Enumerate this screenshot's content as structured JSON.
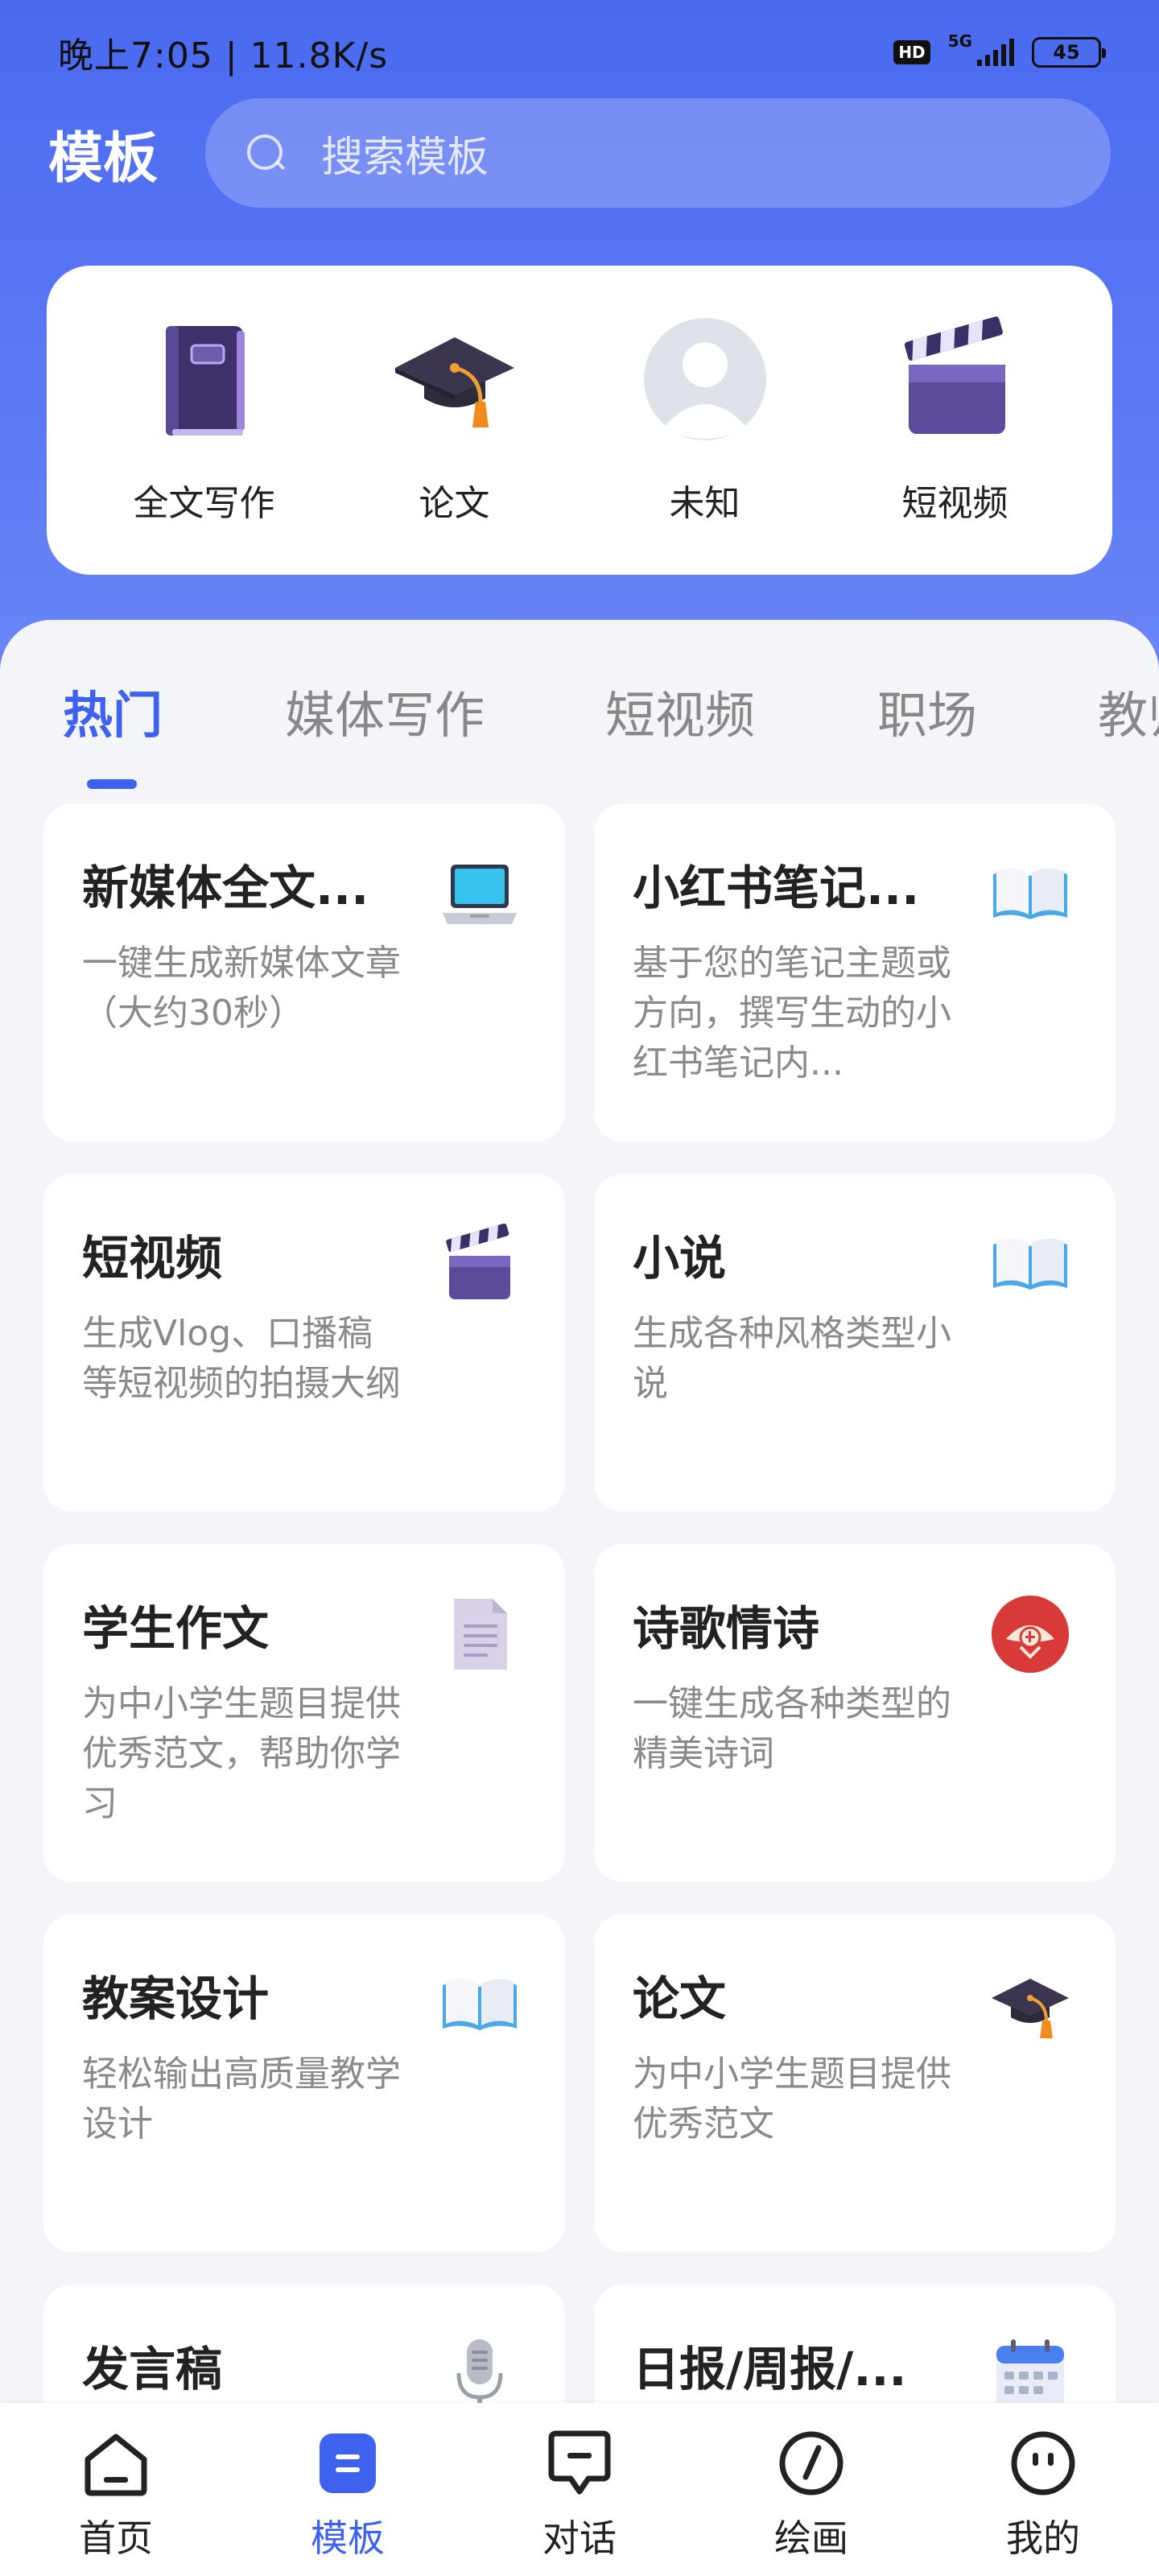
{
  "status_bar": {
    "time": "晚上7:05 | 11.8K/s",
    "hd": "HD",
    "network": "5G",
    "battery": "45"
  },
  "header": {
    "title": "模板",
    "search_placeholder": "搜索模板"
  },
  "categories": [
    {
      "label": "全文写作",
      "icon": "purple-book-icon"
    },
    {
      "label": "论文",
      "icon": "graduation-cap-icon"
    },
    {
      "label": "未知",
      "icon": "default-avatar-icon"
    },
    {
      "label": "短视频",
      "icon": "clapperboard-icon"
    }
  ],
  "tabs": [
    {
      "label": "热门",
      "active": true
    },
    {
      "label": "媒体写作"
    },
    {
      "label": "短视频"
    },
    {
      "label": "职场"
    },
    {
      "label": "教师"
    }
  ],
  "cards": [
    {
      "title": "新媒体全文...",
      "desc": "一键生成新媒体文章（大约30秒）",
      "icon": "laptop-icon"
    },
    {
      "title": "小红书笔记...",
      "desc": "基于您的笔记主题或方向，撰写生动的小红书笔记内...",
      "icon": "open-book-icon"
    },
    {
      "title": "短视频",
      "desc": "生成Vlog、口播稿等短视频的拍摄大纲",
      "icon": "clapperboard-icon"
    },
    {
      "title": "小说",
      "desc": "生成各种风格类型小说",
      "icon": "open-book-icon"
    },
    {
      "title": "学生作文",
      "desc": "为中小学生题目提供优秀范文，帮助你学习",
      "icon": "document-icon"
    },
    {
      "title": "诗歌情诗",
      "desc": "一键生成各种类型的精美诗词",
      "icon": "red-fan-icon"
    },
    {
      "title": "教案设计",
      "desc": "轻松输出高质量教学设计",
      "icon": "open-book-icon"
    },
    {
      "title": "论文",
      "desc": "为中小学生题目提供优秀范文",
      "icon": "graduation-cap-icon"
    },
    {
      "title": "发言稿",
      "desc": "",
      "icon": "microphone-icon"
    },
    {
      "title": "日报/周报/...",
      "desc": "",
      "icon": "calendar-icon"
    }
  ],
  "bottom_nav": [
    {
      "label": "首页",
      "icon": "home-icon"
    },
    {
      "label": "模板",
      "icon": "template-icon",
      "active": true
    },
    {
      "label": "对话",
      "icon": "chat-icon"
    },
    {
      "label": "绘画",
      "icon": "paint-icon"
    },
    {
      "label": "我的",
      "icon": "profile-icon"
    }
  ],
  "colors": {
    "accent": "#3e62f0",
    "header_gradient_top": "#4a6af0",
    "background": "#f4f5f9"
  }
}
